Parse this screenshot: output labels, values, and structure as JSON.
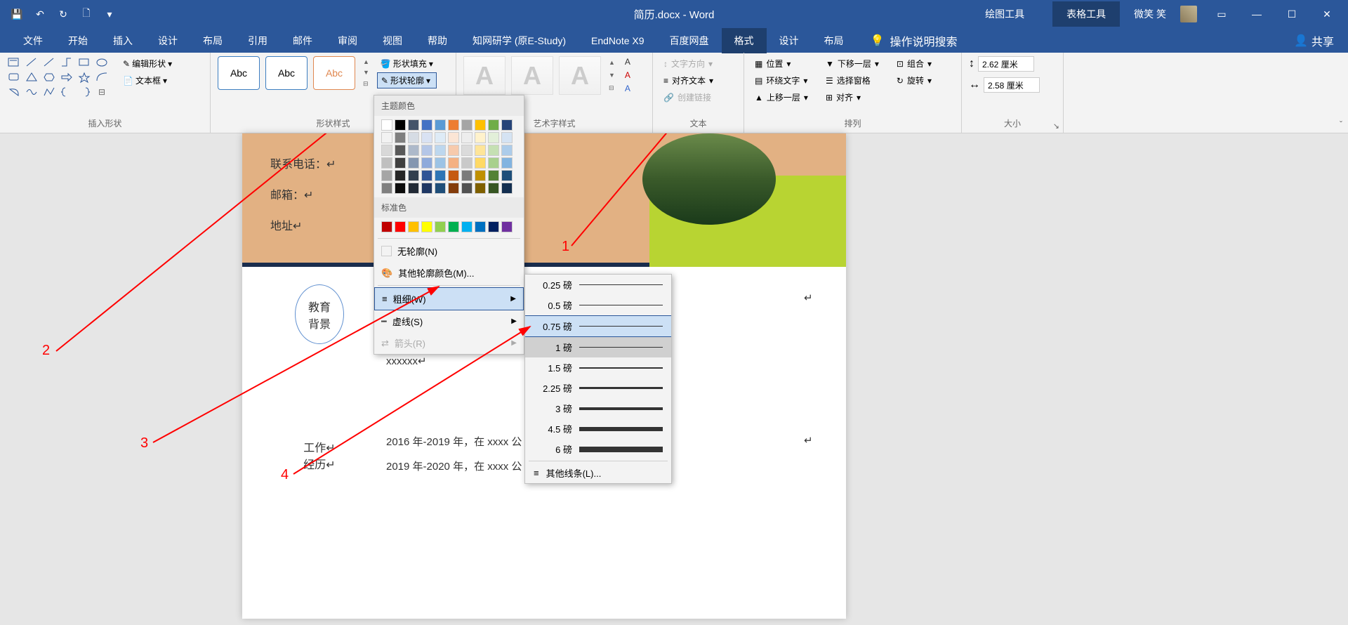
{
  "title": "简历.docx - Word",
  "context_tabs": {
    "drawing": "绘图工具",
    "table": "表格工具"
  },
  "user": "微笑 笑",
  "tabs": [
    "文件",
    "开始",
    "插入",
    "设计",
    "布局",
    "引用",
    "邮件",
    "审阅",
    "视图",
    "帮助",
    "知网研学 (原E-Study)",
    "EndNote X9",
    "百度网盘",
    "格式",
    "设计",
    "布局"
  ],
  "tell_me": "操作说明搜索",
  "share": "共享",
  "ribbon": {
    "insert_shapes": {
      "label": "插入形状",
      "edit_shape": "编辑形状",
      "text_box": "文本框"
    },
    "shape_styles": {
      "label": "形状样式",
      "abc": "Abc",
      "fill": "形状填充",
      "outline": "形状轮廓"
    },
    "wordart_styles": {
      "label": "艺术字样式",
      "A": "A"
    },
    "text": {
      "label": "文本",
      "direction": "文字方向",
      "align": "对齐文本",
      "link": "创建链接"
    },
    "arrange": {
      "label": "排列",
      "position": "位置",
      "wrap": "环绕文字",
      "forward": "上移一层",
      "backward": "下移一层",
      "pane": "选择窗格",
      "align_btn": "对齐",
      "group": "组合",
      "rotate": "旋转"
    },
    "size": {
      "label": "大小",
      "height": "2.62 厘米",
      "width": "2.58 厘米"
    }
  },
  "color_dropdown": {
    "theme": "主题颜色",
    "standard": "标准色",
    "no_outline": "无轮廓(N)",
    "more_colors": "其他轮廓颜色(M)...",
    "weight": "粗细(W)",
    "dashes": "虚线(S)",
    "arrows": "箭头(R)",
    "theme_colors_row1": [
      "#ffffff",
      "#000000",
      "#44546a",
      "#4472c4",
      "#5b9bd5",
      "#ed7d31",
      "#a5a5a5",
      "#ffc000",
      "#70ad47",
      "#264478"
    ],
    "shade_rows": [
      [
        "#f2f2f2",
        "#7f7f7f",
        "#d6dce4",
        "#d9e2f3",
        "#deebf6",
        "#fbe5d5",
        "#ededed",
        "#fff2cc",
        "#e2efd9",
        "#d5e3f3"
      ],
      [
        "#d8d8d8",
        "#595959",
        "#adb9ca",
        "#b4c6e7",
        "#bdd7ee",
        "#f7caac",
        "#dbdbdb",
        "#fee599",
        "#c5e0b3",
        "#acccea"
      ],
      [
        "#bfbfbf",
        "#3f3f3f",
        "#8496b0",
        "#8eaadb",
        "#9cc3e5",
        "#f4b183",
        "#c9c9c9",
        "#ffd965",
        "#a8d08d",
        "#82b4e0"
      ],
      [
        "#a5a5a5",
        "#262626",
        "#323f4f",
        "#2f5496",
        "#2e75b5",
        "#c55a11",
        "#7b7b7b",
        "#bf9000",
        "#538135",
        "#1e4e79"
      ],
      [
        "#7f7f7f",
        "#0c0c0c",
        "#222a35",
        "#1f3864",
        "#1f4e79",
        "#833c0b",
        "#525252",
        "#7f6000",
        "#375623",
        "#132f50"
      ]
    ],
    "standard_colors": [
      "#c00000",
      "#ff0000",
      "#ffc000",
      "#ffff00",
      "#92d050",
      "#00b050",
      "#00b0f0",
      "#0070c0",
      "#002060",
      "#7030a0"
    ]
  },
  "weight_dropdown": {
    "items": [
      "0.25 磅",
      "0.5 磅",
      "0.75 磅",
      "1 磅",
      "1.5 磅",
      "2.25 磅",
      "3 磅",
      "4.5 磅",
      "6 磅"
    ],
    "heights": [
      0.5,
      1,
      1,
      1.5,
      2,
      3,
      4,
      6,
      8
    ],
    "more": "其他线条(L)..."
  },
  "doc": {
    "phone_label": "联系电话：",
    "email_label": "邮箱：",
    "address_label": "地址",
    "edu_1": "教育",
    "edu_2": "背景",
    "work_1": "工作",
    "work_2": "经历",
    "xxx": "xxxxxx",
    "line1": "2016 年-2019 年，在 xxxx 公",
    "line2": "2019 年-2020 年，在 xxxx 公"
  },
  "annotations": {
    "n1": "1",
    "n2": "2",
    "n3": "3",
    "n4": "4"
  }
}
